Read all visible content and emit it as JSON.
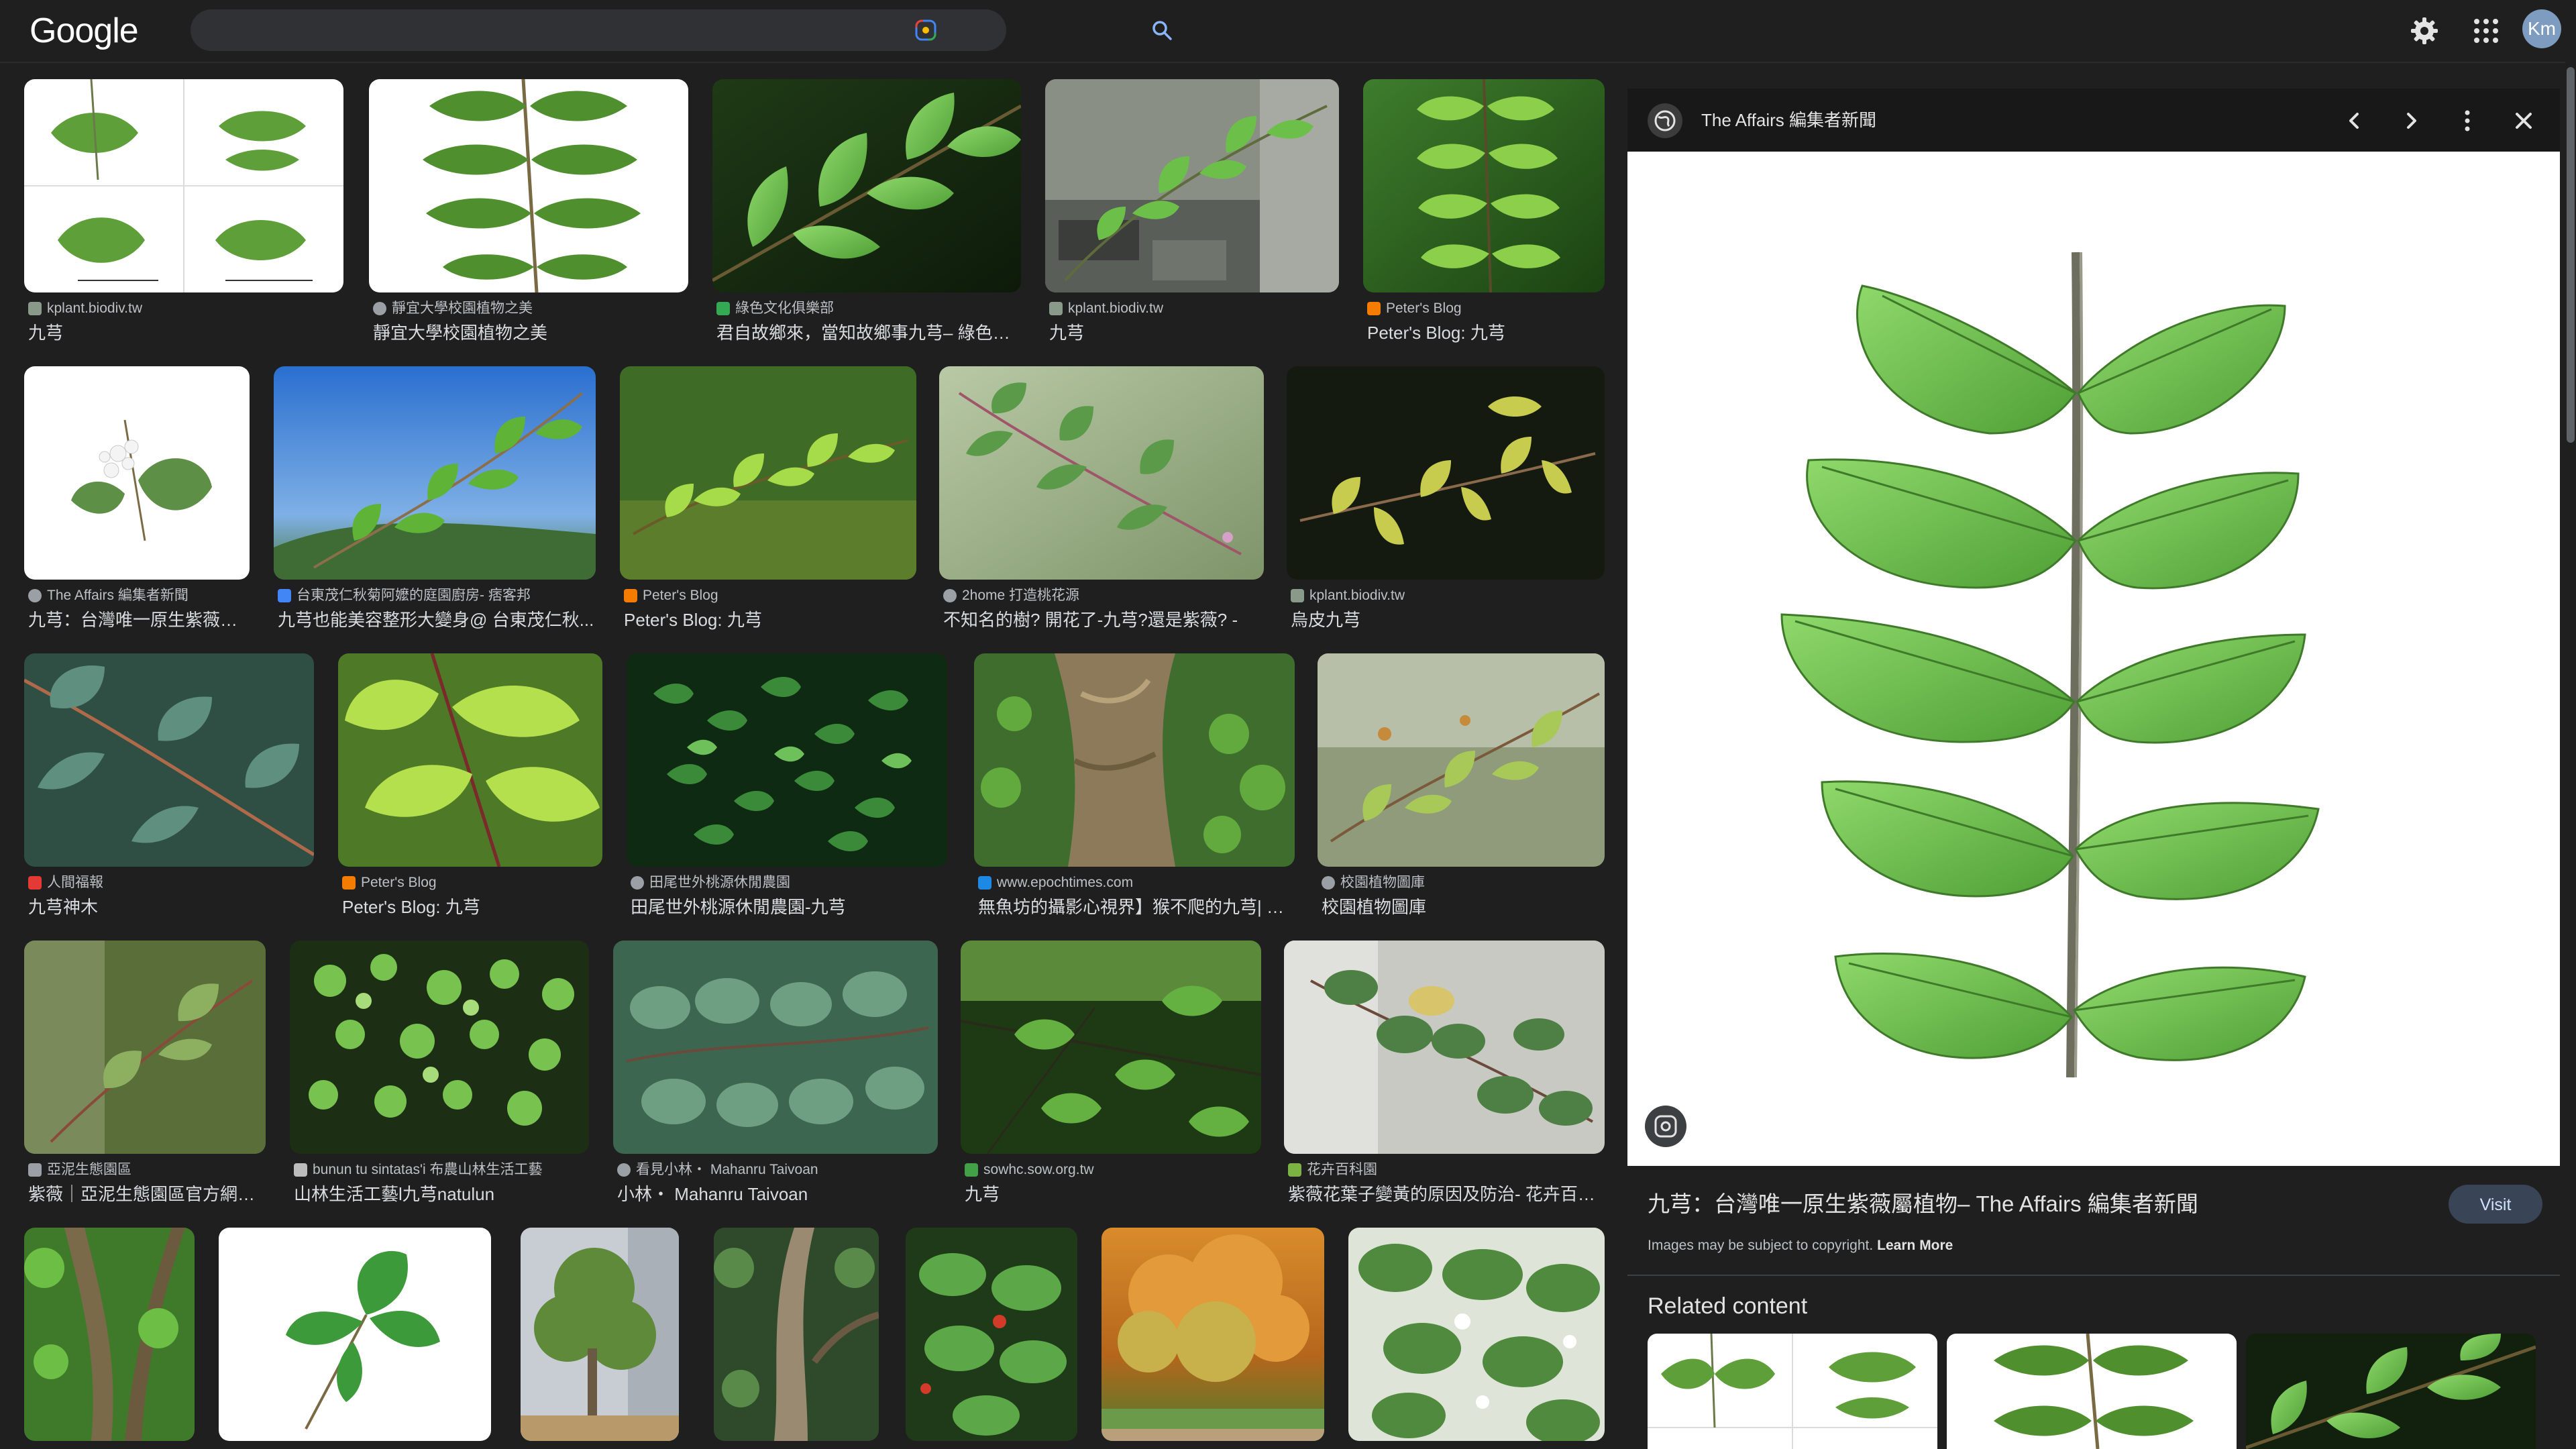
{
  "header": {
    "logo": "Google",
    "search_value": "",
    "lens_icon": "google-lens-icon",
    "search_icon": "search-icon",
    "settings_icon": "gear-icon",
    "apps_icon": "apps-grid-icon",
    "avatar_initials": "Km"
  },
  "results": [
    {
      "source": "kplant.biodiv.tw",
      "title": "九芎",
      "fav": "#8a9a8a"
    },
    {
      "source": "靜宜大學校園植物之美",
      "title": "靜宜大學校園植物之美",
      "fav": "#9aa0a6"
    },
    {
      "source": "綠色文化俱樂部",
      "title": "君自故鄉來，當知故鄉事九芎– 綠色文...",
      "fav": "#34a853"
    },
    {
      "source": "kplant.biodiv.tw",
      "title": "九芎",
      "fav": "#8a9a8a"
    },
    {
      "source": "Peter's Blog",
      "title": "Peter's Blog: 九芎",
      "fav": "#f57c00"
    },
    {
      "source": "The Affairs 編集者新聞",
      "title": "九芎：台灣唯一原生紫薇屬...",
      "fav": "#9aa0a6"
    },
    {
      "source": "台東茂仁秋菊阿嬤的庭園廚房- 痞客邦",
      "title": "九芎也能美容整形大變身@ 台東茂仁秋...",
      "fav": "#4285f4"
    },
    {
      "source": "Peter's Blog",
      "title": "Peter's Blog: 九芎",
      "fav": "#f57c00"
    },
    {
      "source": "2home 打造桃花源",
      "title": "不知名的樹? 開花了-九芎?還是紫薇? -",
      "fav": "#9aa0a6"
    },
    {
      "source": "kplant.biodiv.tw",
      "title": "烏皮九芎",
      "fav": "#8a9a8a"
    },
    {
      "source": "人間福報",
      "title": "九芎神木",
      "fav": "#e53935"
    },
    {
      "source": "Peter's Blog",
      "title": "Peter's Blog: 九芎",
      "fav": "#f57c00"
    },
    {
      "source": "田尾世外桃源休閒農園",
      "title": "田尾世外桃源休閒農園-九芎",
      "fav": "#9aa0a6"
    },
    {
      "source": "www.epochtimes.com",
      "title": "無魚坊的攝影心視界】猴不爬的九芎| 大...",
      "fav": "#1e88e5"
    },
    {
      "source": "校園植物圖庫",
      "title": "校園植物圖庫",
      "fav": "#9aa0a6"
    },
    {
      "source": "亞泥生態園區",
      "title": "紫薇｜亞泥生態園區官方網站...",
      "fav": "#9aa0a6"
    },
    {
      "source": "bunun tu sintatas'i 布農山林生活工藝",
      "title": "山林生活工藝l九芎natulun",
      "fav": "#bdbdbd"
    },
    {
      "source": "看見小林・ Mahanru Taivoan",
      "title": "小林・ Mahanru Taivoan",
      "fav": "#9aa0a6"
    },
    {
      "source": "sowhc.sow.org.tw",
      "title": "九芎",
      "fav": "#43a047"
    },
    {
      "source": "花卉百科園",
      "title": "紫薇花葉子變黃的原因及防治- 花卉百科...",
      "fav": "#7cb342"
    }
  ],
  "panel": {
    "source": "The Affairs 編集者新聞",
    "title": "九芎：台灣唯一原生紫薇屬植物– The Affairs 編集者新聞",
    "visit_label": "Visit",
    "copyright": "Images may be subject to copyright.",
    "learn_more": "Learn More",
    "related_heading": "Related content",
    "icons": [
      "globe-icon",
      "chevron-left-icon",
      "chevron-right-icon",
      "more-vert-icon",
      "close-icon",
      "google-lens-icon"
    ]
  },
  "colors": {
    "background": "#1f1f1f",
    "search_bar": "#303134",
    "visit_button": "#394457",
    "leaf_green": "#6cc04a"
  }
}
